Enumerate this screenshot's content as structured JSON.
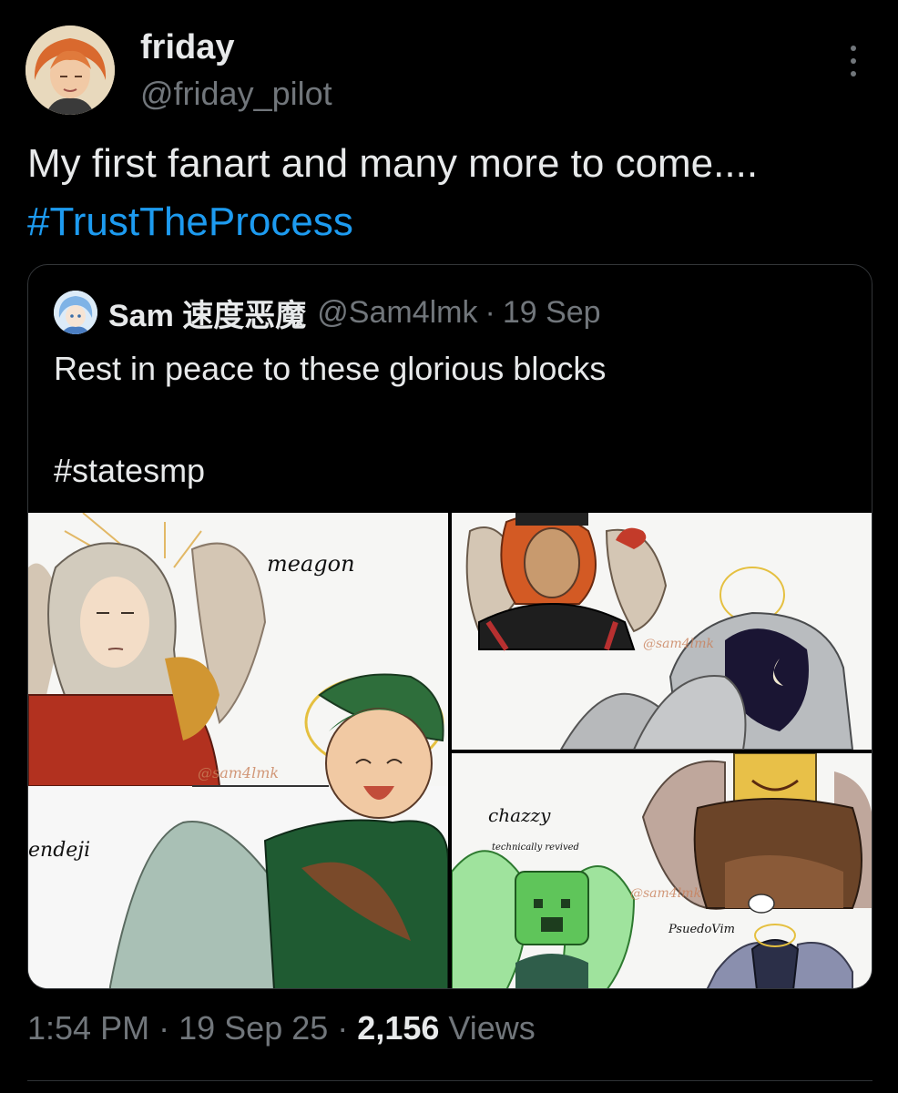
{
  "author": {
    "display_name": "friday",
    "handle": "@friday_pilot"
  },
  "tweet": {
    "text": "My first fanart and many more to come.... ",
    "hashtag": "#TrustTheProcess"
  },
  "quoted": {
    "name": "Sam 速度恶魔",
    "handle": "@Sam4lmk",
    "separator": "·",
    "date": "19 Sep",
    "text": "Rest in peace to these glorious blocks\n\n#statesmp",
    "media_labels": {
      "meagon": "meagon",
      "endeji": "endeji",
      "chazzy": "chazzy",
      "technically": "technically revived",
      "pseudo": "PsuedoVim",
      "watermark": "@sam4lmk"
    }
  },
  "meta": {
    "time": "1:54 PM",
    "separator": "·",
    "date": "19 Sep 25",
    "views_count": "2,156",
    "views_label": "Views"
  },
  "icons": {
    "more": "more-vertical-icon"
  }
}
